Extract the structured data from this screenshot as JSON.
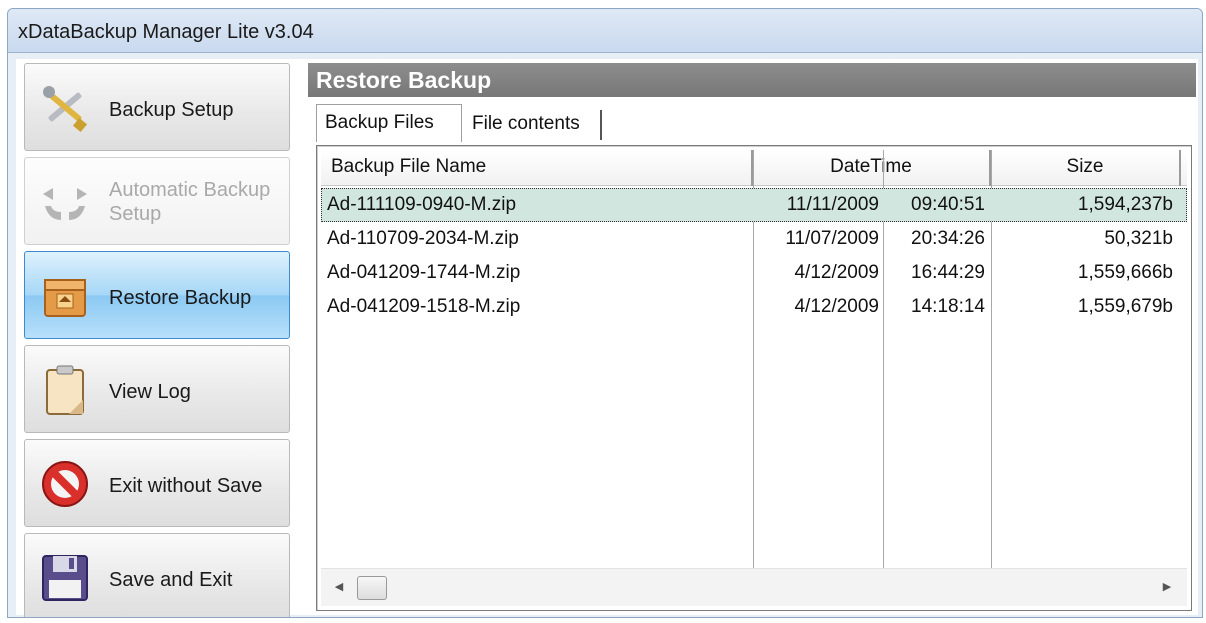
{
  "window": {
    "title": "xDataBackup Manager Lite v3.04"
  },
  "sidebar": {
    "items": [
      {
        "label": "Backup Setup",
        "icon": "tools-icon",
        "state": "normal"
      },
      {
        "label": "Automatic Backup Setup",
        "icon": "arrows-cycle-icon",
        "state": "disabled"
      },
      {
        "label": "Restore Backup",
        "icon": "restore-box-icon",
        "state": "active"
      },
      {
        "label": "View Log",
        "icon": "clipboard-icon",
        "state": "normal"
      },
      {
        "label": "Exit without Save",
        "icon": "no-entry-icon",
        "state": "normal"
      },
      {
        "label": "Save and Exit",
        "icon": "floppy-disk-icon",
        "state": "normal"
      }
    ]
  },
  "main": {
    "title": "Restore Backup",
    "tabs": [
      {
        "label": "Backup Files",
        "active": true
      },
      {
        "label": "File contents",
        "active": false
      }
    ],
    "table": {
      "columns": {
        "name": "Backup File Name",
        "datetime": "DateTime",
        "size": "Size"
      },
      "rows": [
        {
          "name": "Ad-111109-0940-M.zip",
          "date": "11/11/2009",
          "time": "09:40:51",
          "size": "1,594,237b",
          "selected": true
        },
        {
          "name": "Ad-110709-2034-M.zip",
          "date": "11/07/2009",
          "time": "20:34:26",
          "size": "50,321b",
          "selected": false
        },
        {
          "name": "Ad-041209-1744-M.zip",
          "date": "4/12/2009",
          "time": "16:44:29",
          "size": "1,559,666b",
          "selected": false
        },
        {
          "name": "Ad-041209-1518-M.zip",
          "date": "4/12/2009",
          "time": "14:18:14",
          "size": "1,559,679b",
          "selected": false
        }
      ]
    }
  },
  "colors": {
    "active_button": "#a6d7f7",
    "header_bar": "#808080",
    "selected_row": "#d2e6e0"
  }
}
